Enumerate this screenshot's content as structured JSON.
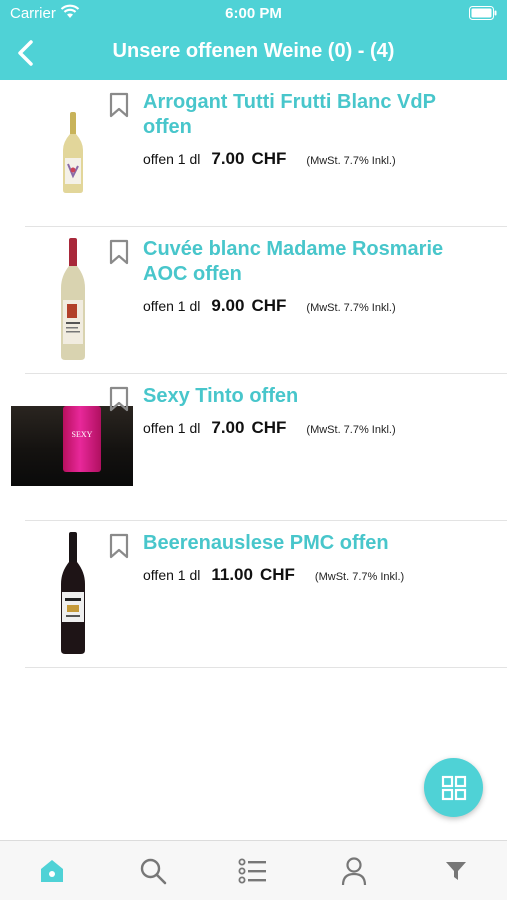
{
  "status_bar": {
    "carrier": "Carrier",
    "time": "6:00 PM"
  },
  "header": {
    "title": "Unsere offenen Weine (0) - (4)",
    "background_color": "#4fd2d6"
  },
  "wines": [
    {
      "name": "Arrogant Tutti Frutti Blanc VdP offen",
      "unit": "offen 1 dl",
      "price": "7.00",
      "currency": "CHF",
      "vat": "(MwSt. 7.7% Inkl.)",
      "image": "white-wine-bottle"
    },
    {
      "name": "Cuvée blanc Madame Rosmarie AOC offen",
      "unit": "offen 1 dl",
      "price": "9.00",
      "currency": "CHF",
      "vat": "(MwSt. 7.7% Inkl.)",
      "image": "white-wine-bottle-red-label"
    },
    {
      "name": "Sexy Tinto offen",
      "unit": "offen 1 dl",
      "price": "7.00",
      "currency": "CHF",
      "vat": "(MwSt. 7.7% Inkl.)",
      "image": "pink-can-photo",
      "image_text": "SEXY"
    },
    {
      "name": "Beerenauslese PMC offen",
      "unit": "offen 1 dl",
      "price": "11.00",
      "currency": "CHF",
      "vat": "(MwSt. 7.7% Inkl.)",
      "image": "dark-dessert-wine-bottle"
    }
  ],
  "fab": {
    "icon": "grid-icon"
  },
  "tab_bar": {
    "items": [
      {
        "icon": "home-icon",
        "active": true
      },
      {
        "icon": "search-icon",
        "active": false
      },
      {
        "icon": "list-icon",
        "active": false
      },
      {
        "icon": "user-icon",
        "active": false
      },
      {
        "icon": "filter-icon",
        "active": false
      }
    ],
    "active_color": "#4fd2d6",
    "inactive_color": "#777777"
  },
  "colors": {
    "accent": "#4fd2d6",
    "title_text": "#48c6cb"
  }
}
